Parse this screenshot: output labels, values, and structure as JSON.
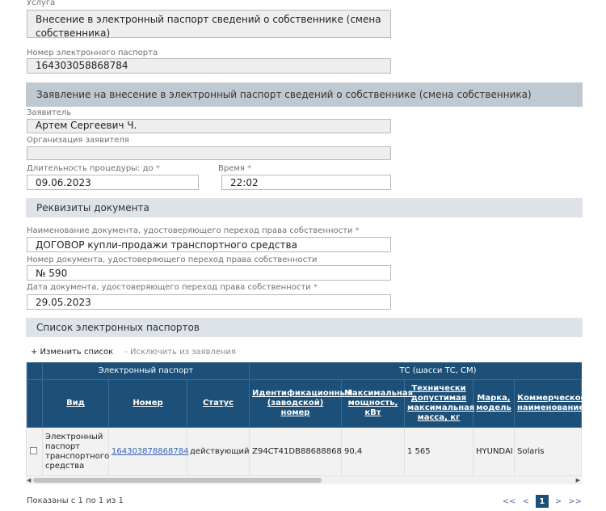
{
  "service": {
    "label": "Услуга",
    "value": "Внесение в электронный паспорт сведений о собственнике (смена собственника)"
  },
  "passport_number": {
    "label": "Номер электронного паспорта",
    "value": "164303058868784"
  },
  "section_application": "Заявление на внесение в электронный паспорт сведений о собственнике (смена собственника)",
  "applicant": {
    "label": "Заявитель",
    "value": "Артем Сергеевич Ч."
  },
  "applicant_org": {
    "label": "Организация заявителя",
    "value": ""
  },
  "duration": {
    "label": "Длительность процедуры: до",
    "required": "*",
    "value": "09.06.2023"
  },
  "time": {
    "label": "Время",
    "required": "*",
    "value": "22:02"
  },
  "section_document": "Реквизиты документа",
  "doc_name": {
    "label": "Наименование документа, удостоверяющего переход права собственности",
    "required": "*",
    "value": "ДОГОВОР купли-продажи транспортного средства"
  },
  "doc_number": {
    "label": "Номер документа, удостоверяющего переход права собственности",
    "value": "№ 590"
  },
  "doc_date": {
    "label": "Дата документа, удостоверяющего переход права собственности",
    "required": "*",
    "value": "29.05.2023"
  },
  "section_list": "Список электронных паспортов",
  "list_actions": {
    "change": "+ Изменить список",
    "exclude": "- Исключить из заявления"
  },
  "table": {
    "group_passport": "Электронный паспорт",
    "group_vehicle": "ТС (шасси ТС, СМ)",
    "columns": [
      "Вид",
      "Номер",
      "Статус",
      "Идентификационный (заводской) номер",
      "Максимальная мощность, кВт",
      "Технически допустимая максимальная масса, кг",
      "Марка, модель",
      "Коммерческое наименование"
    ],
    "rows": [
      {
        "kind": "Электронный паспорт транспортного средства",
        "number": "164303878868784",
        "status": "действующий",
        "vin": "Z94CT41DB88688868",
        "power": "90,4",
        "mass": "1 565",
        "brand": "HYUNDAI",
        "commercial": "Solaris"
      }
    ]
  },
  "pagination": {
    "info": "Показаны с 1 по 1 из 1",
    "first": "<<",
    "prev": "<",
    "current": "1",
    "next": ">",
    "last": ">>"
  },
  "scroll_left": "◀",
  "scroll_right": "▶",
  "colors": {
    "header_blue": "#1c5078",
    "band": "#dde3e9",
    "band_dark": "#bfc9d2",
    "link": "#3a65b7"
  }
}
